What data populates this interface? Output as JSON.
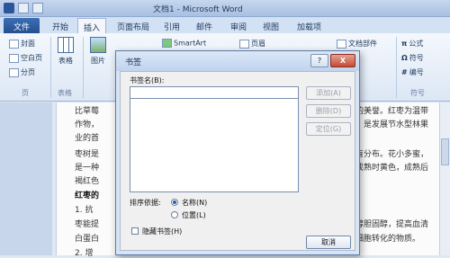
{
  "window": {
    "title": "文档1 - Microsoft Word"
  },
  "ribbon_tabs": [
    "文件",
    "开始",
    "插入",
    "页面布局",
    "引用",
    "邮件",
    "审阅",
    "视图",
    "加载项"
  ],
  "ribbon": {
    "pages_group": {
      "items": [
        "封面",
        "空白页",
        "分页"
      ],
      "label": "页"
    },
    "table_button": "表格",
    "tables_group_label": "表格",
    "picture_button": "图片",
    "smartart_button": "SmartArt",
    "header_button": "页眉",
    "parts_button": "文档部件",
    "formula_button": "公式",
    "symbol_button": "符号",
    "number_button": "编号",
    "symbols_group_label": "符号"
  },
  "document": {
    "lines": [
      "比草莓",
      "作物，",
      "业的首",
      "枣树是",
      "是一种",
      "褐红色",
      "红枣的",
      "1. 抗",
      "枣能提",
      "白蛋白",
      "2. 增"
    ],
    "right_lines": [
      "的美誉。红枣为温带",
      "，是发展节水型林果",
      "有分布。花小多蜜，",
      "成熟时黄色，成熟后",
      "醇胆固醇，提高血清",
      "细胞转化的物质。"
    ]
  },
  "dialog": {
    "title": "书签",
    "name_label": "书签名(B):",
    "name_value": "",
    "add_button": "添加(A)",
    "delete_button": "删除(D)",
    "goto_button": "定位(G)",
    "sort_label": "排序依据:",
    "sort_name": "名称(N)",
    "sort_position": "位置(L)",
    "hidden_label": "隐藏书签(H)",
    "cancel_button": "取消",
    "help_button": "?",
    "close_button": "X"
  }
}
